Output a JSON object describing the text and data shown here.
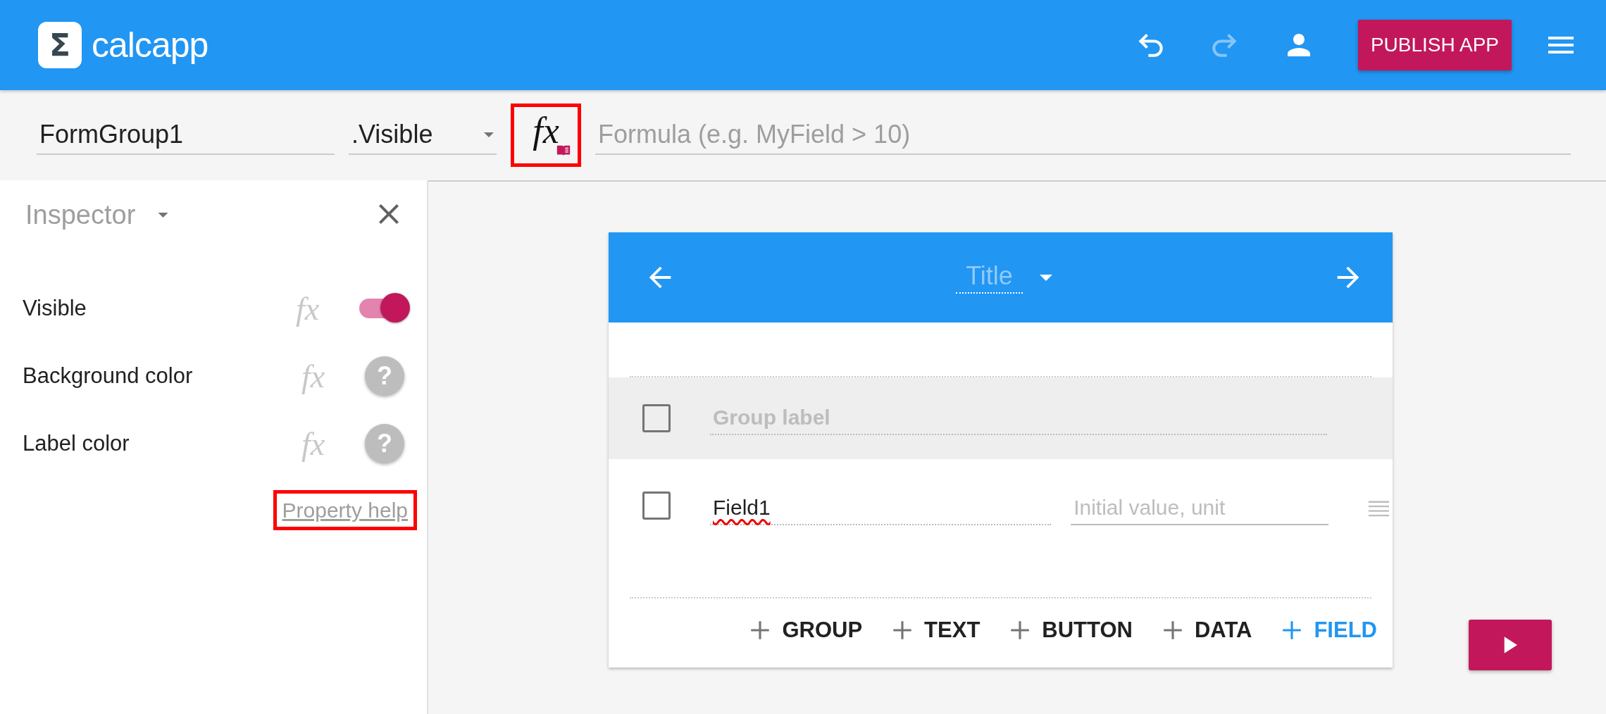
{
  "app_bar": {
    "logo_glyph": "Σ",
    "title": "calcapp",
    "redo_disabled": true,
    "publish_button": "PUBLISH APP"
  },
  "formula_bar": {
    "name_value": "FormGroup1",
    "property": ".Visible",
    "fx_glyph": "fx",
    "fx_highlighted": true,
    "formula_placeholder": "Formula (e.g. MyField > 10)"
  },
  "inspector": {
    "title": "Inspector",
    "properties": [
      {
        "label": "Visible",
        "formula_glyph": "fx",
        "kind": "toggle",
        "on": true
      },
      {
        "label": "Background color",
        "formula_glyph": "fx",
        "kind": "help",
        "help_glyph": "?"
      },
      {
        "label": "Label color",
        "formula_glyph": "fx",
        "kind": "help",
        "help_glyph": "?"
      }
    ],
    "help_link": {
      "label": "Property help",
      "highlighted": true
    }
  },
  "card": {
    "title": "Title",
    "group": {
      "label_placeholder": "Group label",
      "checked": false
    },
    "field": {
      "name": "Field1",
      "checked": false,
      "value_placeholder": "Initial value, unit"
    },
    "add_buttons": [
      {
        "label": "GROUP",
        "selected": false
      },
      {
        "label": "TEXT",
        "selected": false
      },
      {
        "label": "BUTTON",
        "selected": false
      },
      {
        "label": "DATA",
        "selected": false
      },
      {
        "label": "FIELD",
        "selected": true
      }
    ]
  }
}
